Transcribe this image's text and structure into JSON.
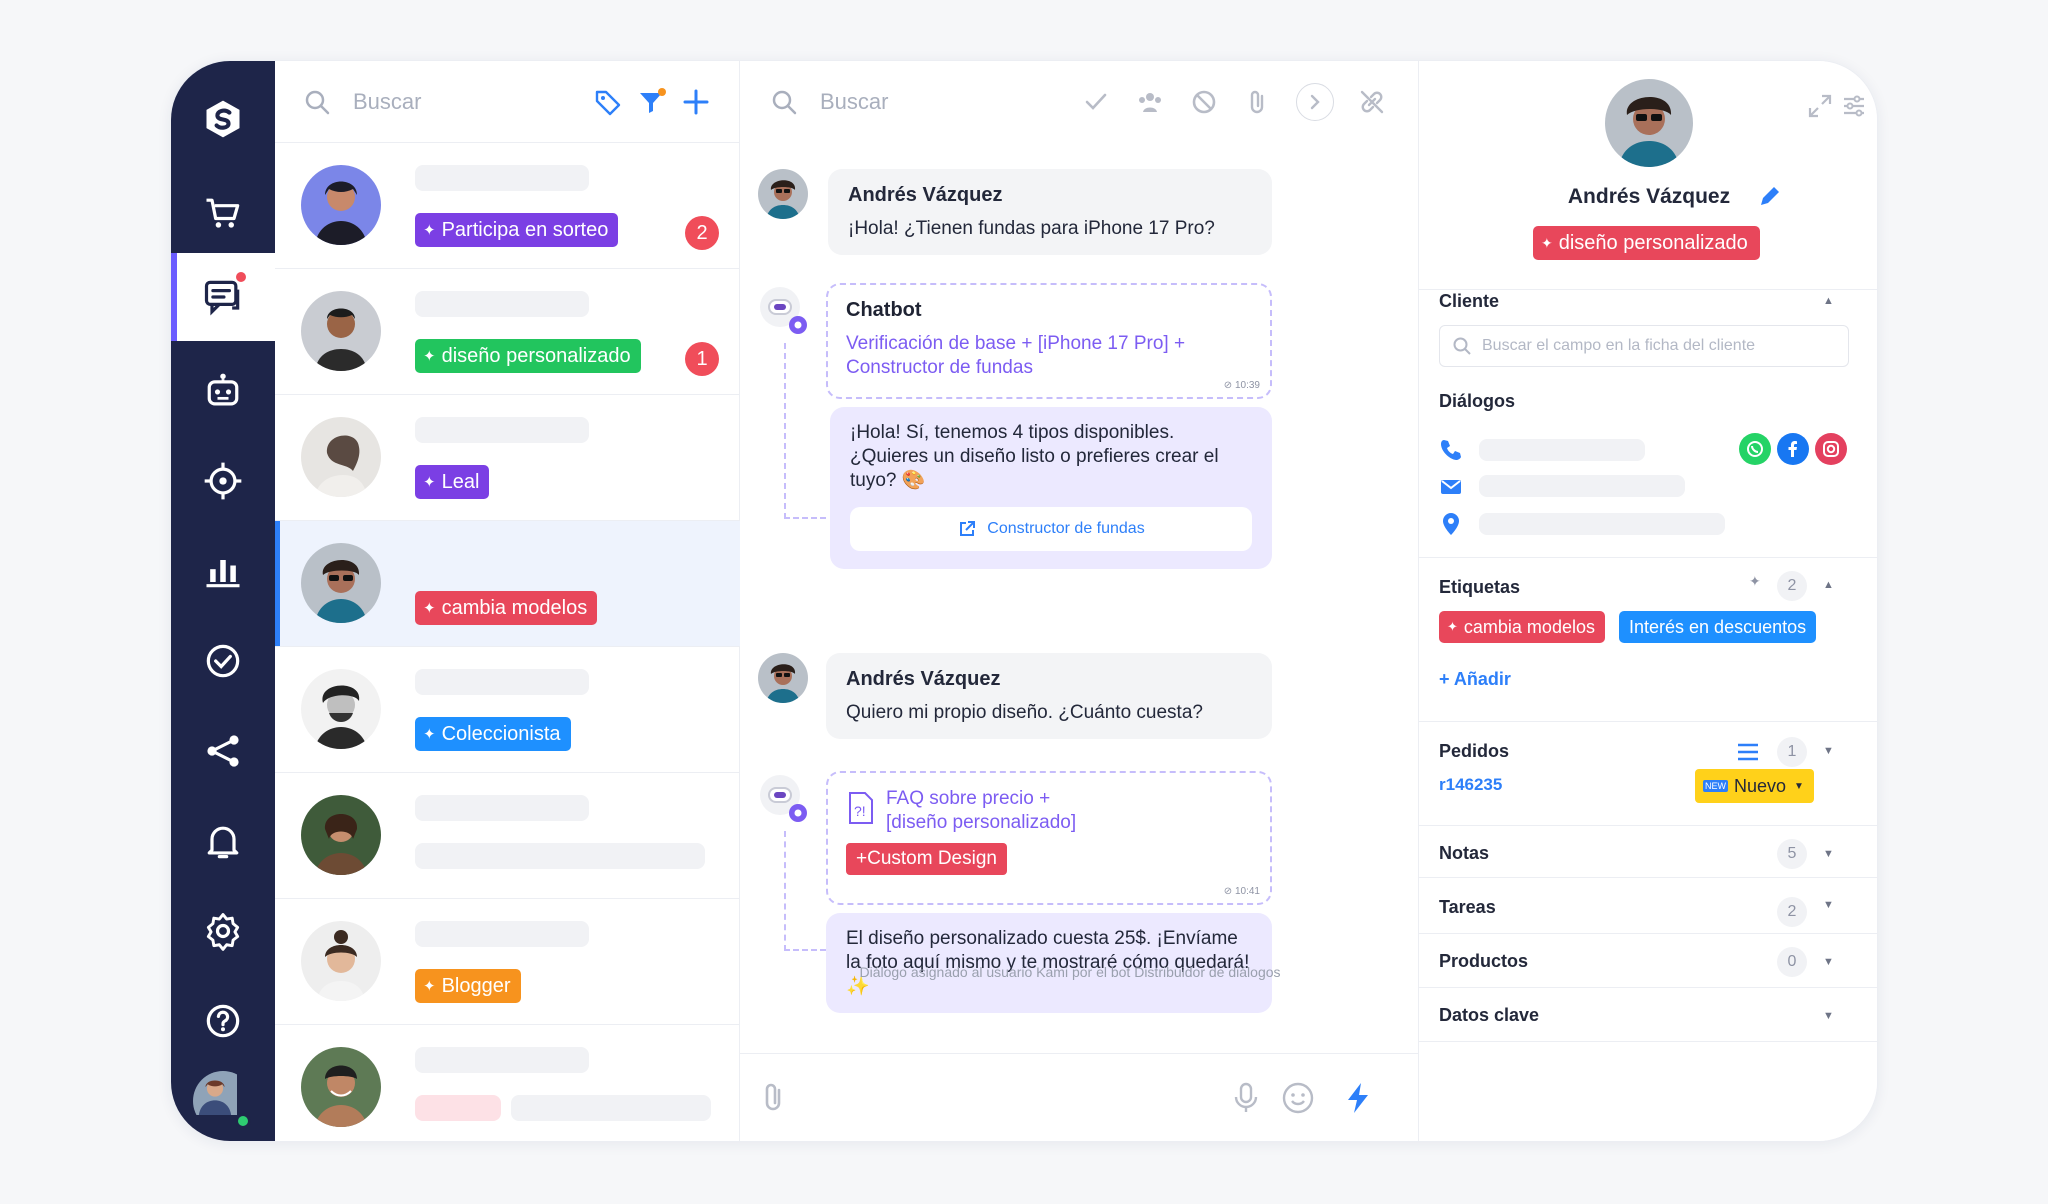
{
  "list_search": {
    "placeholder": "Buscar"
  },
  "chat_search": {
    "placeholder": "Buscar"
  },
  "conversations": [
    {
      "tag": "Participa en sorteo",
      "tag_color": "#7b3fe4",
      "unread": "2"
    },
    {
      "tag": "diseño personalizado",
      "tag_color": "#22c55e",
      "unread": "1"
    },
    {
      "tag": "Leal",
      "tag_color": "#7b3fe4"
    },
    {
      "tag": "cambia modelos",
      "tag_color": "#e8475b"
    },
    {
      "tag": "Coleccionista",
      "tag_color": "#1e90ff"
    },
    {
      "tag": ""
    },
    {
      "tag": "Blogger",
      "tag_color": "#f7931e"
    },
    {
      "tag": ""
    }
  ],
  "messages": {
    "m1_author": "Andrés Vázquez",
    "m1_text": "¡Hola! ¿Tienen fundas para iPhone 17 Pro?",
    "bot1_author": "Chatbot",
    "bot1_flow": "Verificación de base + [iPhone 17 Pro] + Constructor de fundas",
    "bot1_time": "10:39",
    "bot1_reply": "¡Hola! Sí, tenemos 4 tipos disponibles. ¿Quieres un diseño listo o prefieres crear el tuyo?",
    "bot1_button": "Constructor de fundas",
    "m2_author": "Andrés Vázquez",
    "m2_text": "Quiero mi propio diseño. ¿Cuánto cuesta?",
    "bot2_flow": "FAQ sobre precio + [diseño personalizado]",
    "bot2_tag": "+Custom Design",
    "bot2_time": "10:41",
    "bot2_reply": "El diseño personalizado cuesta 25$. ¡Envíame la foto aquí mismo y te mostraré cómo quedará!",
    "assign_note": "Diálogo asignado al usuario Kami por el bot Distribuidor de diálogos"
  },
  "profile": {
    "name": "Andrés Vázquez",
    "tag": "diseño personalizado"
  },
  "sections": {
    "cliente": "Cliente",
    "cliente_search_placeholder": "Buscar el campo en la ficha del cliente",
    "dialogos": "Diálogos",
    "etiquetas": "Etiquetas",
    "etiquetas_count": "2",
    "etiqueta_1": "cambia modelos",
    "etiqueta_2": "Interés en descuentos",
    "add_label": "+ Añadir",
    "pedidos": "Pedidos",
    "pedidos_count": "1",
    "order_id": "r146235",
    "order_status": "Nuevo",
    "notas": "Notas",
    "notas_count": "5",
    "tareas": "Tareas",
    "tareas_count": "2",
    "productos": "Productos",
    "productos_count": "0",
    "datos_clave": "Datos clave"
  }
}
